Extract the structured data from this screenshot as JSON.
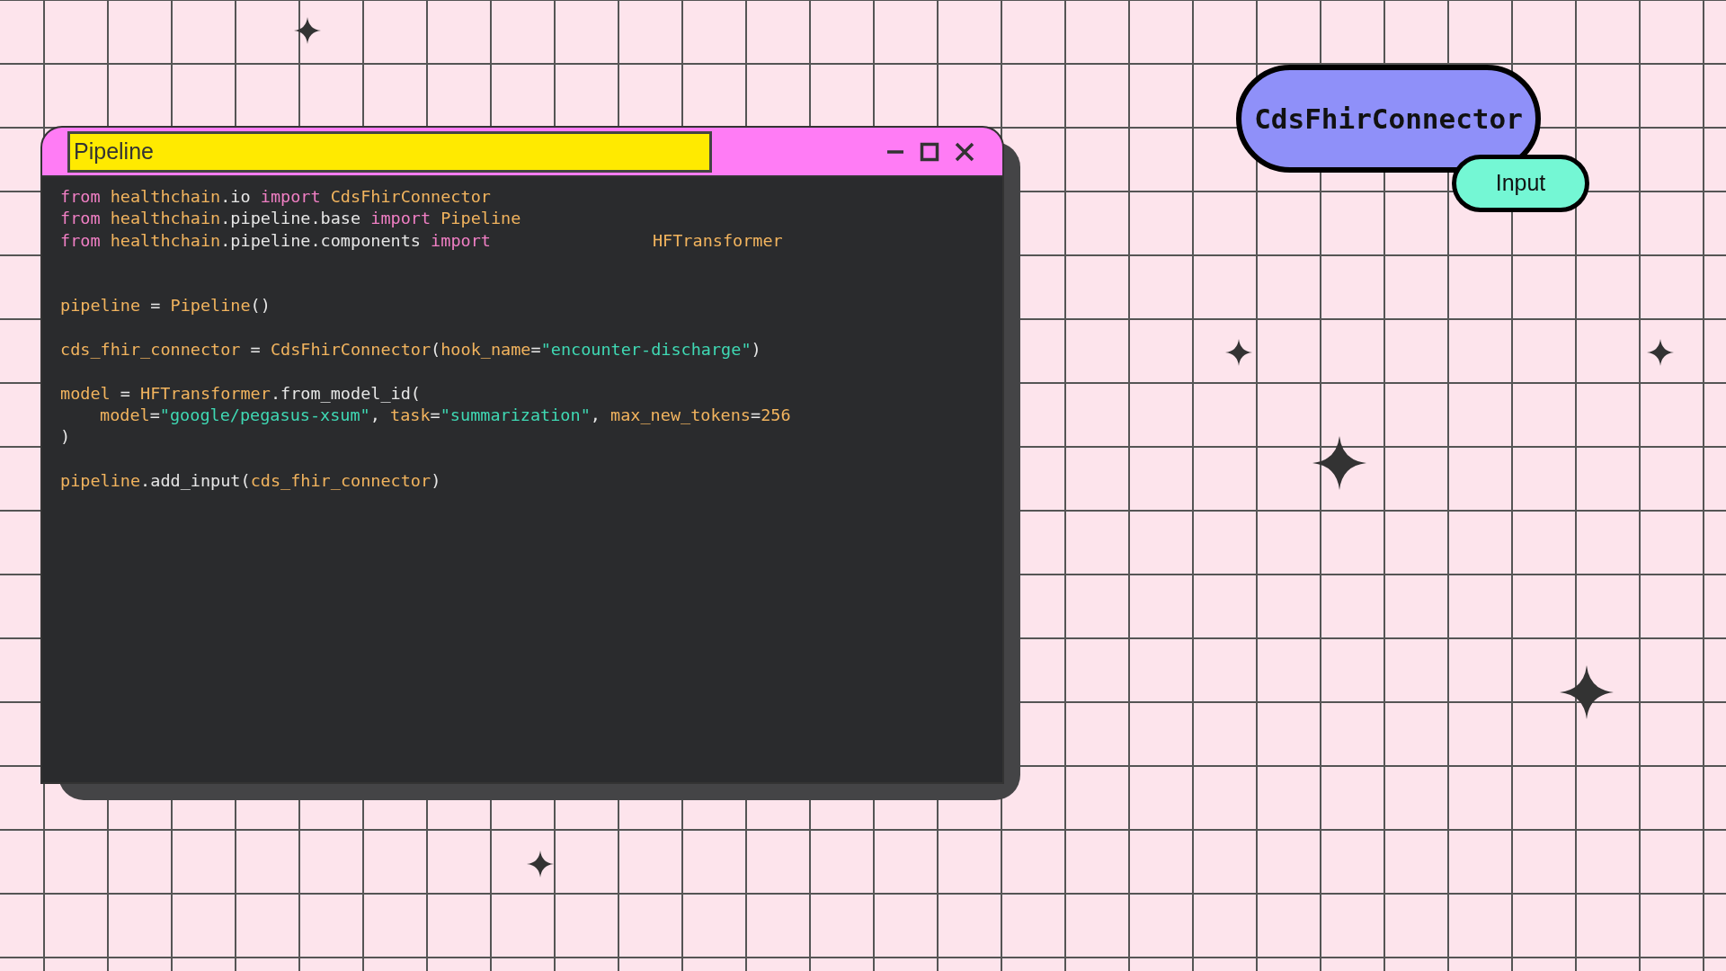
{
  "window": {
    "title": "Pipeline"
  },
  "code": {
    "lines": [
      {
        "kind": "code",
        "tokens": [
          {
            "kind": "keyword",
            "text": "from"
          },
          {
            "kind": "name",
            "text": "healthchain",
            "gap": true
          },
          {
            "kind": "plain",
            "text": ".io"
          },
          {
            "kind": "keyword",
            "text": "import",
            "gap": true
          },
          {
            "kind": "name",
            "text": "CdsFhirConnector",
            "gap": true
          }
        ]
      },
      {
        "kind": "code",
        "tokens": [
          {
            "kind": "keyword",
            "text": "from"
          },
          {
            "kind": "name",
            "text": "healthchain",
            "gap": true
          },
          {
            "kind": "plain",
            "text": ".pipeline.base"
          },
          {
            "kind": "keyword",
            "text": "import",
            "gap": true
          },
          {
            "kind": "name",
            "text": "Pipeline",
            "gap": true
          }
        ]
      },
      {
        "kind": "code",
        "tokens": [
          {
            "kind": "keyword",
            "text": "from"
          },
          {
            "kind": "name",
            "text": "healthchain",
            "gap": true
          },
          {
            "kind": "plain",
            "text": ".pipeline.components"
          },
          {
            "kind": "keyword",
            "text": "import",
            "gap": true
          },
          {
            "kind": "name_far",
            "text": "HFTransformer"
          }
        ]
      },
      {
        "kind": "blank"
      },
      {
        "kind": "blank"
      },
      {
        "kind": "code",
        "tokens": [
          {
            "kind": "name",
            "text": "pipeline"
          },
          {
            "kind": "plain",
            "text": "=",
            "gap": true
          },
          {
            "kind": "name",
            "text": "Pipeline",
            "gap": true
          },
          {
            "kind": "plain",
            "text": "()"
          }
        ]
      },
      {
        "kind": "blank"
      },
      {
        "kind": "code",
        "tokens": [
          {
            "kind": "name",
            "text": "cds_fhir_connector"
          },
          {
            "kind": "plain",
            "text": "=",
            "gap": true
          },
          {
            "kind": "name",
            "text": "CdsFhirConnector",
            "gap": true
          },
          {
            "kind": "plain",
            "text": "("
          },
          {
            "kind": "name",
            "text": "hook_name"
          },
          {
            "kind": "plain",
            "text": "="
          },
          {
            "kind": "string",
            "text": "\"encounter-discharge\""
          },
          {
            "kind": "plain",
            "text": ")"
          }
        ]
      },
      {
        "kind": "blank"
      },
      {
        "kind": "code",
        "tokens": [
          {
            "kind": "name",
            "text": "model"
          },
          {
            "kind": "plain",
            "text": "=",
            "gap": true
          },
          {
            "kind": "name",
            "text": "HFTransformer",
            "gap": true
          },
          {
            "kind": "plain",
            "text": ".from_model_id("
          }
        ]
      },
      {
        "kind": "code",
        "indent": true,
        "tokens": [
          {
            "kind": "name",
            "text": "model"
          },
          {
            "kind": "plain",
            "text": "="
          },
          {
            "kind": "string",
            "text": "\"google/pegasus-xsum\""
          },
          {
            "kind": "plain",
            "text": ","
          },
          {
            "kind": "name",
            "text": "task",
            "gap": true
          },
          {
            "kind": "plain",
            "text": "="
          },
          {
            "kind": "string",
            "text": "\"summarization\""
          },
          {
            "kind": "plain",
            "text": ","
          },
          {
            "kind": "name",
            "text": "max_new_tokens",
            "gap": true
          },
          {
            "kind": "plain",
            "text": "="
          },
          {
            "kind": "name",
            "text": "256"
          }
        ]
      },
      {
        "kind": "code",
        "tokens": [
          {
            "kind": "plain",
            "text": ")"
          }
        ]
      },
      {
        "kind": "blank"
      },
      {
        "kind": "code",
        "tokens": [
          {
            "kind": "name",
            "text": "pipeline"
          },
          {
            "kind": "plain",
            "text": ".add_input("
          },
          {
            "kind": "name",
            "text": "cds_fhir_connector"
          },
          {
            "kind": "plain",
            "text": ")"
          }
        ]
      }
    ]
  },
  "component_pill": {
    "label": "CdsFhirConnector"
  },
  "role_pill": {
    "label": "Input"
  }
}
